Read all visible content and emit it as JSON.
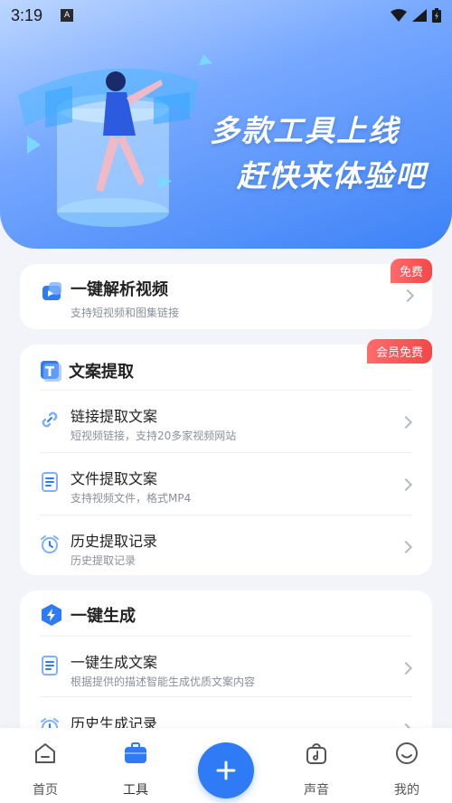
{
  "status_bar": {
    "time": "3:19",
    "notification_icon": "a-text-icon",
    "icons": [
      "wifi-icon",
      "signal-icon",
      "battery-charging-icon"
    ]
  },
  "hero": {
    "line1": "多款工具上线",
    "line2": "赶快来体验吧"
  },
  "video_parse": {
    "title": "一键解析视频",
    "subtitle": "支持短视频和图集链接",
    "badge": "免费"
  },
  "copy_extract": {
    "title": "文案提取",
    "badge": "会员免费",
    "items": [
      {
        "title": "链接提取文案",
        "subtitle": "短视频链接，支持20多家视频网站",
        "icon": "link-icon"
      },
      {
        "title": "文件提取文案",
        "subtitle": "支持视频文件，格式MP4",
        "icon": "document-icon"
      },
      {
        "title": "历史提取记录",
        "subtitle": "历史提取记录",
        "icon": "alarm-clock-icon"
      }
    ]
  },
  "one_click_generate": {
    "title": "一键生成",
    "items": [
      {
        "title": "一键生成文案",
        "subtitle": "根据提供的描述智能生成优质文案内容",
        "icon": "document-icon"
      },
      {
        "title": "历史生成记录",
        "subtitle": "",
        "icon": "alarm-clock-icon"
      }
    ]
  },
  "tabbar": {
    "items": [
      {
        "label": "首页",
        "icon": "home-icon"
      },
      {
        "label": "工具",
        "icon": "toolbox-icon"
      },
      {
        "label": "声音",
        "icon": "music-bag-icon"
      },
      {
        "label": "我的",
        "icon": "smiley-icon"
      }
    ],
    "center_icon": "plus-icon"
  },
  "colors": {
    "accent": "#2f7bf5",
    "badge_red": "#f24848",
    "hero_gradient_start": "#bcd6ff",
    "hero_gradient_end": "#3d82f7"
  }
}
